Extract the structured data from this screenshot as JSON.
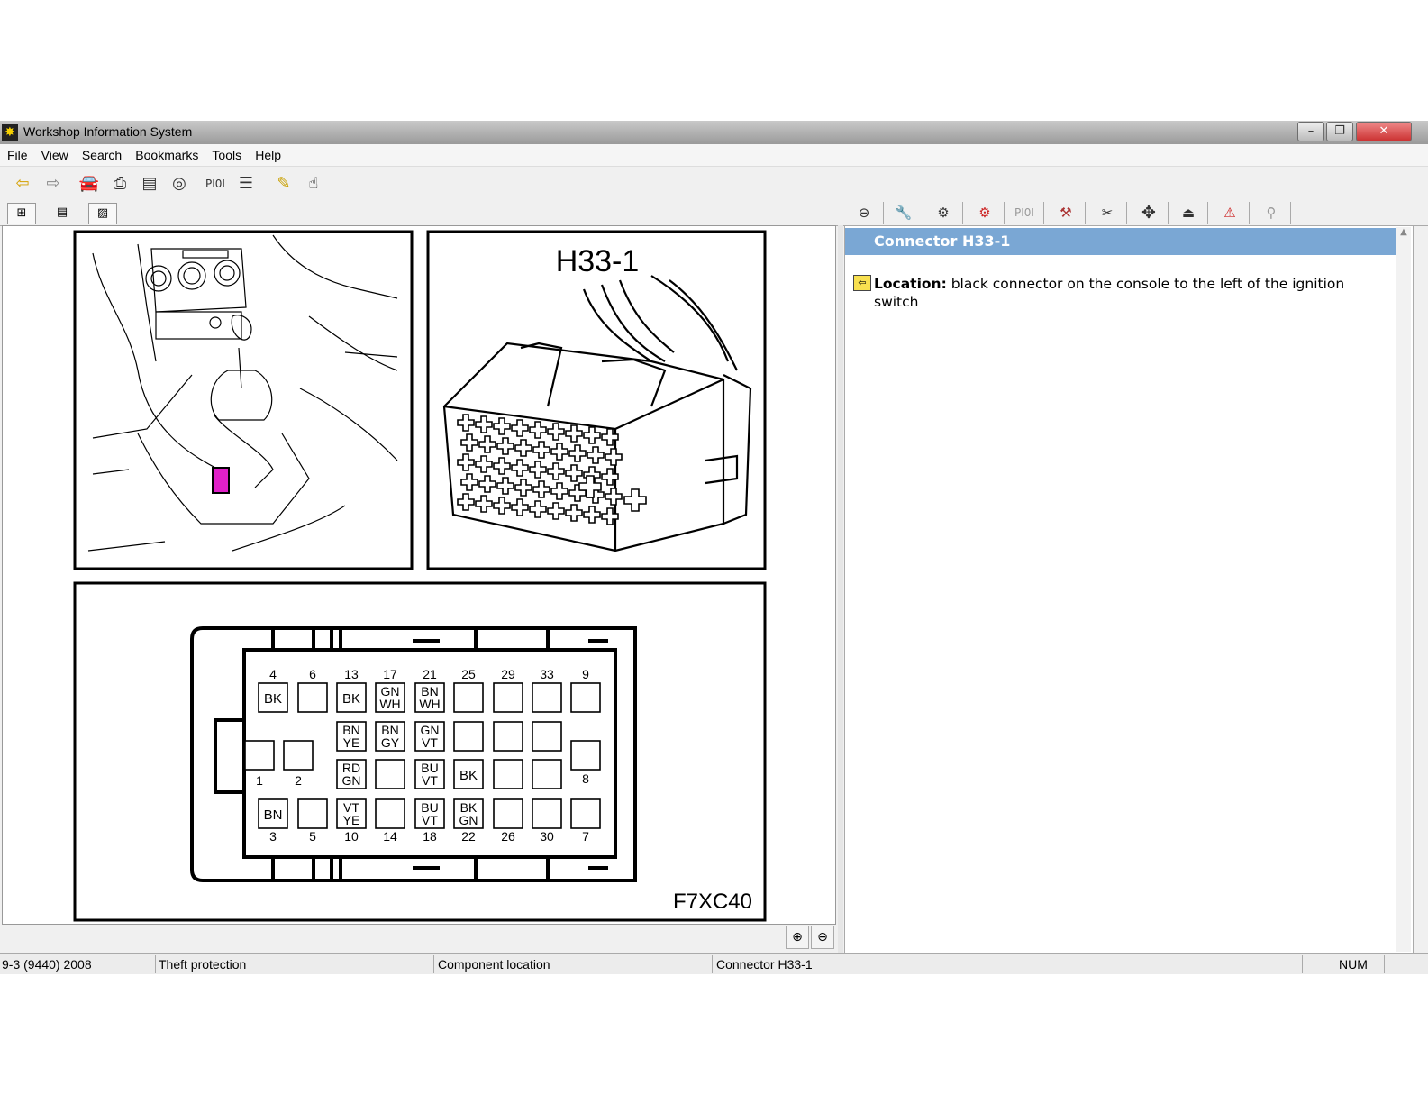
{
  "window": {
    "title": "Workshop Information System"
  },
  "menu": [
    "File",
    "View",
    "Search",
    "Bookmarks",
    "Tools",
    "Help"
  ],
  "toolbar": {
    "icons": [
      "back-arrow-icon",
      "forward-arrow-icon",
      "car-icon",
      "printer-icon",
      "document-export-icon",
      "binoculars-icon",
      "pi-icon",
      "speech-icon",
      "pencil-icon",
      "pointer-icon"
    ],
    "pi_label": "PI0I"
  },
  "right_toolbar": {
    "icons": [
      "steering-icon",
      "wrench-icon",
      "gears-icon",
      "engine-icon",
      "pi-icon",
      "knife-icon",
      "tools-icon",
      "move-icon",
      "tree-icon",
      "alert-icon",
      "tool-icon"
    ],
    "pi_label": "PI0I"
  },
  "diagram": {
    "connector_title": "H33-1",
    "figure_code": "F7XC40",
    "top_pins": [
      "4",
      "6",
      "13",
      "17",
      "21",
      "25",
      "29",
      "33",
      "9"
    ],
    "bottom_pins": [
      "3",
      "5",
      "10",
      "14",
      "18",
      "22",
      "26",
      "30",
      "7"
    ],
    "side_pins": [
      "1",
      "2",
      "8"
    ],
    "row1": [
      "BK",
      "",
      "BK",
      "GN\nWH",
      "BN\nWH",
      "",
      "",
      "",
      ""
    ],
    "row2": [
      "BN\nYE",
      "BN\nGY",
      "GN\nVT",
      "",
      "",
      ""
    ],
    "row3": [
      "RD\nGN",
      "",
      "BU\nVT",
      "BK",
      "",
      ""
    ],
    "row4": [
      "BN",
      "",
      "VT\nYE",
      "",
      "BU\nVT",
      "BK\nGN",
      "",
      "",
      ""
    ]
  },
  "detail": {
    "heading": "Connector H33-1",
    "location_label": "Location:",
    "location_text": "black connector on the console to the left of the ignition switch"
  },
  "status": {
    "model": "9-3 (9440) 2008",
    "section": "Theft protection",
    "category": "Component location",
    "item": "Connector H33-1",
    "num": "NUM"
  }
}
